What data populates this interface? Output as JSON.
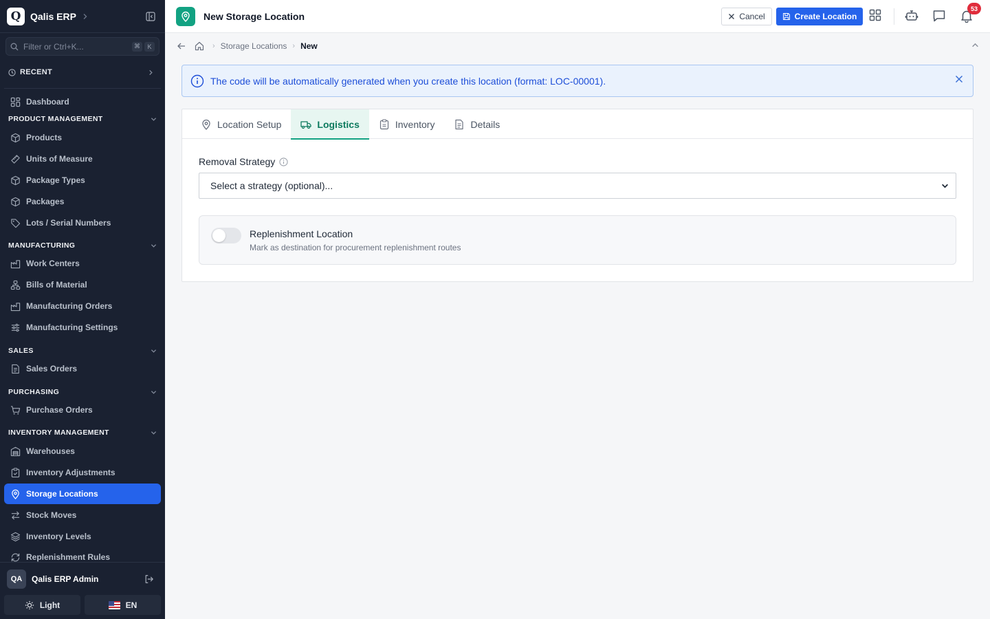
{
  "app": {
    "name": "Qalis ERP",
    "logo_letter": "Q"
  },
  "sidebar": {
    "search_placeholder": "Filter or Ctrl+K...",
    "search_shortcut": [
      "⌘",
      "K"
    ],
    "recent_label": "RECENT",
    "dashboard": "Dashboard",
    "sections": {
      "product": "PRODUCT MANAGEMENT",
      "manufacturing": "MANUFACTURING",
      "sales": "SALES",
      "purchasing": "PURCHASING",
      "inventory": "INVENTORY MANAGEMENT"
    },
    "items": {
      "products": "Products",
      "uom": "Units of Measure",
      "package_types": "Package Types",
      "packages": "Packages",
      "lots": "Lots / Serial Numbers",
      "work_centers": "Work Centers",
      "bom": "Bills of Material",
      "mfg_orders": "Manufacturing Orders",
      "mfg_settings": "Manufacturing Settings",
      "sales_orders": "Sales Orders",
      "purchase_orders": "Purchase Orders",
      "warehouses": "Warehouses",
      "inv_adjustments": "Inventory Adjustments",
      "storage_locations": "Storage Locations",
      "stock_moves": "Stock Moves",
      "inv_levels": "Inventory Levels",
      "replenishment": "Replenishment Rules"
    },
    "user": {
      "initials": "QA",
      "name": "Qalis ERP Admin"
    },
    "theme_label": "Light",
    "lang_label": "EN"
  },
  "header": {
    "title": "New Storage Location",
    "cancel": "Cancel",
    "create": "Create Location",
    "notification_count": "53"
  },
  "breadcrumb": {
    "parent": "Storage Locations",
    "current": "New"
  },
  "info_banner": {
    "text": "The code will be automatically generated when you create this location (format: LOC-00001)."
  },
  "tabs": {
    "location_setup": "Location Setup",
    "logistics": "Logistics",
    "inventory": "Inventory",
    "details": "Details"
  },
  "form": {
    "removal_strategy_label": "Removal Strategy",
    "removal_strategy_placeholder": "Select a strategy (optional)...",
    "replenishment_title": "Replenishment Location",
    "replenishment_desc": "Mark as destination for procurement replenishment routes",
    "replenishment_on": false
  },
  "colors": {
    "accent": "#2563eb",
    "brand_green": "#12a282",
    "sidebar_bg": "#1a2131",
    "badge": "#e02d3c"
  }
}
